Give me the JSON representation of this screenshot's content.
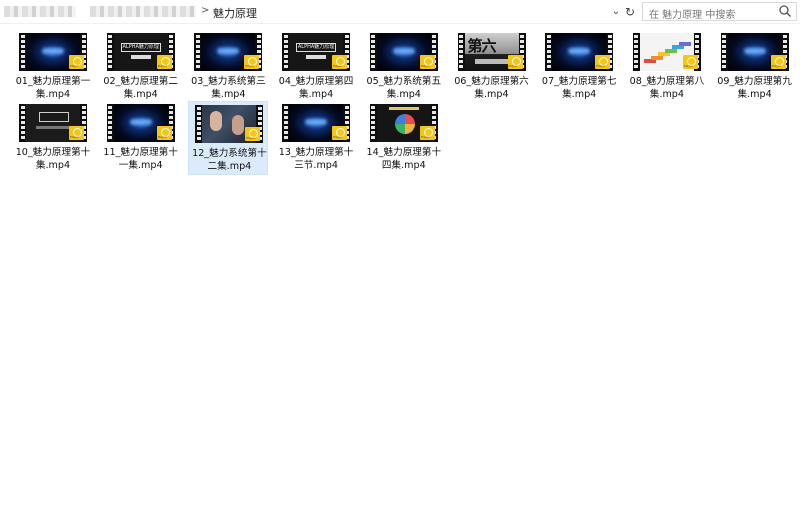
{
  "address_bar": {
    "current_folder": "魅力原理",
    "separator": ">",
    "dropdown_glyph": "⌄",
    "refresh_glyph": "↻"
  },
  "search": {
    "placeholder": "在 魅力原理 中搜索",
    "icon": "search-icon"
  },
  "files": [
    {
      "name": "01_魅力原理第一集.mp4",
      "thumb": "blue-glow"
    },
    {
      "name": "02_魅力原理第二集.mp4",
      "thumb": "title-card",
      "thumb_text": "ALPHA魅力原理"
    },
    {
      "name": "03_魅力系统第三集.mp4",
      "thumb": "blue-glow"
    },
    {
      "name": "04_魅力原理第四集.mp4",
      "thumb": "title-card",
      "thumb_text": "ALPHA魅力原理"
    },
    {
      "name": "05_魅力系统第五集.mp4",
      "thumb": "blue-glow"
    },
    {
      "name": "06_魅力原理第六集.mp4",
      "thumb": "big-text",
      "thumb_text": "第六"
    },
    {
      "name": "07_魅力原理第七集.mp4",
      "thumb": "blue-glow"
    },
    {
      "name": "08_魅力原理第八集.mp4",
      "thumb": "steps"
    },
    {
      "name": "09_魅力原理第九集.mp4",
      "thumb": "blue-glow"
    },
    {
      "name": "10_魅力原理第十集.mp4",
      "thumb": "dark-title"
    },
    {
      "name": "11_魅力原理第十一集.mp4",
      "thumb": "blue-glow"
    },
    {
      "name": "12_魅力系统第十二集.mp4",
      "thumb": "faces",
      "selected": true
    },
    {
      "name": "13_魅力原理第十三节.mp4",
      "thumb": "blue-glow"
    },
    {
      "name": "14_魅力原理第十四集.mp4",
      "thumb": "ring-chart"
    }
  ],
  "file_badge": {
    "label": "Player",
    "color": "#f5c518"
  },
  "colors": {
    "selection": "#dcebfc",
    "text": "#111111"
  }
}
